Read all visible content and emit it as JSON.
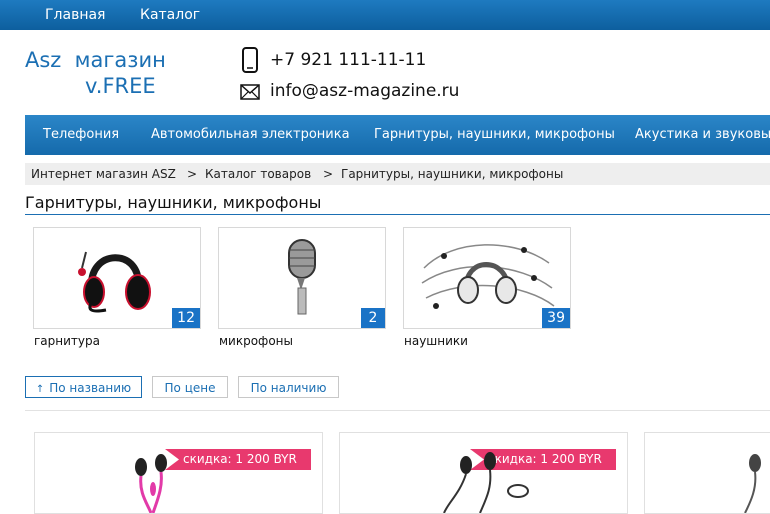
{
  "topnav": {
    "items": [
      {
        "label": "Главная"
      },
      {
        "label": "Каталог"
      }
    ]
  },
  "brand": {
    "line1": "Asz  магазин",
    "line2": "v.FREE"
  },
  "contact": {
    "phone": "+7 921 111-11-11",
    "email": "info@asz-magazine.ru"
  },
  "mainnav": {
    "items": [
      {
        "label": "Телефония"
      },
      {
        "label": "Автомобильная электроника"
      },
      {
        "label": "Гарнитуры, наушники, микрофоны"
      },
      {
        "label": "Акустика и звуковые"
      }
    ]
  },
  "breadcrumb": {
    "items": [
      "Интернет магазин ASZ",
      "Каталог товаров",
      "Гарнитуры, наушники, микрофоны"
    ],
    "separator": ">"
  },
  "page": {
    "title": "Гарнитуры, наушники, микрофоны"
  },
  "categories": [
    {
      "label": "гарнитура",
      "count": "12",
      "icon": "headset-icon"
    },
    {
      "label": "микрофоны",
      "count": "2",
      "icon": "microphone-icon"
    },
    {
      "label": "наушники",
      "count": "39",
      "icon": "headphones-icon"
    }
  ],
  "sort": {
    "arrow": "↑",
    "options": [
      {
        "label": "По названию",
        "active": true
      },
      {
        "label": "По цене"
      },
      {
        "label": "По наличию"
      }
    ]
  },
  "products": [
    {
      "discount": "скидка: 1 200 BYR",
      "icon": "earphones-icon"
    },
    {
      "discount": "скидка: 1 200 BYR",
      "icon": "earphones-icon"
    },
    {
      "icon": "earphones-icon"
    }
  ],
  "colors": {
    "accent": "#1b6fb3",
    "badge": "#1a73c6",
    "discount": "#e8396e"
  }
}
